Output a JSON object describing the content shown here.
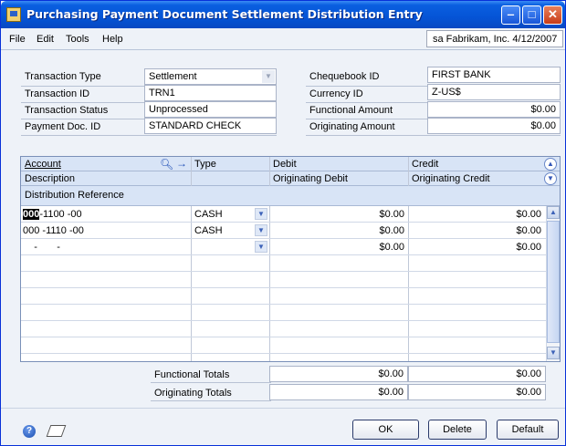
{
  "window": {
    "title": "Purchasing Payment Document Settlement Distribution Entry",
    "controls": [
      "minimize",
      "maximize",
      "close"
    ]
  },
  "menu": {
    "items": [
      "File",
      "Edit",
      "Tools",
      "Help"
    ],
    "user_info": "sa  Fabrikam, Inc.  4/12/2007"
  },
  "header": {
    "transaction_type_label": "Transaction Type",
    "transaction_type_value": "Settlement",
    "transaction_id_label": "Transaction ID",
    "transaction_id_value": "TRN1",
    "transaction_status_label": "Transaction Status",
    "transaction_status_value": "Unprocessed",
    "payment_doc_id_label": "Payment Doc. ID",
    "payment_doc_id_value": "STANDARD CHECK",
    "chequebook_id_label": "Chequebook ID",
    "chequebook_id_value": "FIRST BANK",
    "currency_id_label": "Currency ID",
    "currency_id_value": "Z-US$",
    "functional_amount_label": "Functional Amount",
    "functional_amount_value": "$0.00",
    "originating_amount_label": "Originating Amount",
    "originating_amount_value": "$0.00"
  },
  "grid": {
    "headers": {
      "account": "Account",
      "type": "Type",
      "debit": "Debit",
      "credit": "Credit",
      "description": "Description",
      "originating_debit": "Originating Debit",
      "originating_credit": "Originating Credit",
      "distribution_reference": "Distribution Reference"
    },
    "rows": [
      {
        "account_sel": "000",
        "account_rest": "-1100 -00",
        "type": "CASH",
        "debit": "$0.00",
        "credit": "$0.00"
      },
      {
        "account_sel": "",
        "account_rest": "000 -1110 -00",
        "type": "CASH",
        "debit": "$0.00",
        "credit": "$0.00"
      },
      {
        "account_sel": "",
        "account_rest": "    -       -",
        "type": "",
        "debit": "$0.00",
        "credit": "$0.00"
      }
    ]
  },
  "totals": {
    "functional_label": "Functional Totals",
    "functional_debit": "$0.00",
    "functional_credit": "$0.00",
    "originating_label": "Originating Totals",
    "originating_debit": "$0.00",
    "originating_credit": "$0.00"
  },
  "buttons": {
    "ok": "OK",
    "delete": "Delete",
    "default": "Default"
  },
  "icons": {
    "help": "help-icon",
    "note": "note-icon",
    "lookup": "lookup-magnifier-icon",
    "expand": "expand-arrow-icon"
  }
}
